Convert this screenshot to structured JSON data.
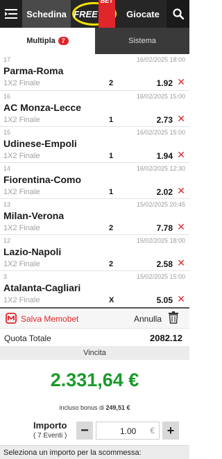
{
  "header": {
    "menu_icon": "hamburger-menu-icon",
    "tab_schedina": "Schedina",
    "freebet_free": "FREE",
    "freebet_bet": "BET",
    "tab_giocate": "Giocate",
    "search_icon": "search-icon"
  },
  "subtabs": {
    "multipla": "Multipla",
    "multipla_count": "7",
    "sistema": "Sistema"
  },
  "bets": [
    {
      "idx": "17",
      "date": "16/02/2025 18:00",
      "match": "Parma-Roma",
      "market": "1X2 Finale",
      "sign": "2",
      "odd": "1.92"
    },
    {
      "idx": "16",
      "date": "16/02/2025 15:00",
      "match": "AC Monza-Lecce",
      "market": "1X2 Finale",
      "sign": "1",
      "odd": "2.73"
    },
    {
      "idx": "15",
      "date": "16/02/2025 15:00",
      "match": "Udinese-Empoli",
      "market": "1X2 Finale",
      "sign": "1",
      "odd": "1.94"
    },
    {
      "idx": "14",
      "date": "16/02/2025 12:30",
      "match": "Fiorentina-Como",
      "market": "1X2 Finale",
      "sign": "1",
      "odd": "2.02"
    },
    {
      "idx": "13",
      "date": "15/02/2025 20:45",
      "match": "Milan-Verona",
      "market": "1X2 Finale",
      "sign": "2",
      "odd": "7.78"
    },
    {
      "idx": "12",
      "date": "15/02/2025 18:00",
      "match": "Lazio-Napoli",
      "market": "1X2 Finale",
      "sign": "2",
      "odd": "2.58"
    },
    {
      "idx": "3",
      "date": "15/02/2025 15:00",
      "match": "Atalanta-Cagliari",
      "market": "1X2 Finale",
      "sign": "X",
      "odd": "5.05"
    }
  ],
  "actions": {
    "salva_memobet": "Salva Memobet",
    "annulla": "Annulla"
  },
  "summary": {
    "quota_label": "Quota Totale",
    "quota_value": "2082.12",
    "vincita_label": "Vincita",
    "vincita_value": "2.331,64 €",
    "bonus_prefix": "incluso bonus di",
    "bonus_value": "249,51 €"
  },
  "importo": {
    "label": "Importo",
    "eventi": "( 7 Eventi )",
    "minus": "−",
    "amount": "1.00",
    "currency": "€",
    "plus": "+"
  },
  "footer": {
    "message": "Seleziona un importo per la scommessa:"
  },
  "colors": {
    "accent_red": "#e0262b",
    "win_green": "#1a9a2a",
    "header_dark": "#262626",
    "freebet_ring": "#f5e400"
  }
}
